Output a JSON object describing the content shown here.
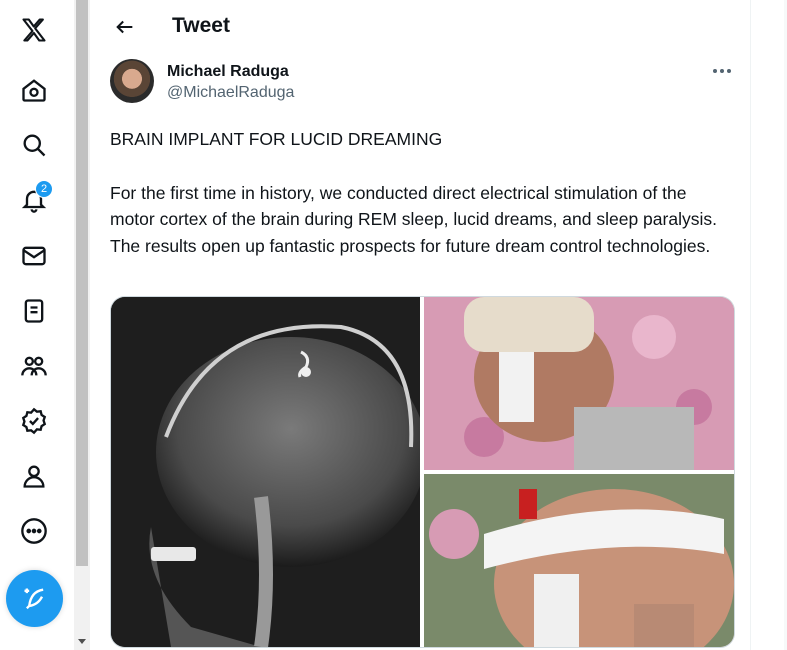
{
  "nav": {
    "items": [
      {
        "name": "x-logo-icon"
      },
      {
        "name": "home-icon"
      },
      {
        "name": "search-icon"
      },
      {
        "name": "notifications-icon",
        "badge": "2"
      },
      {
        "name": "messages-icon"
      },
      {
        "name": "lists-icon"
      },
      {
        "name": "communities-icon"
      },
      {
        "name": "verified-icon"
      },
      {
        "name": "profile-icon"
      },
      {
        "name": "more-icon"
      }
    ],
    "compose": {
      "name": "compose-icon"
    }
  },
  "header": {
    "title": "Tweet"
  },
  "tweet": {
    "author_name": "Michael Raduga",
    "author_handle": "@MichaelRaduga",
    "headline": "BRAIN IMPLANT FOR LUCID DREAMING",
    "body": "For the first time in history, we conducted direct electrical stimulation of the motor cortex of the brain during REM sleep, lucid dreams, and sleep paralysis. The results open up fantastic prospects for future dream control technologies."
  },
  "colors": {
    "accent": "#1d9bf0",
    "text": "#0f1419",
    "secondary": "#536471"
  }
}
